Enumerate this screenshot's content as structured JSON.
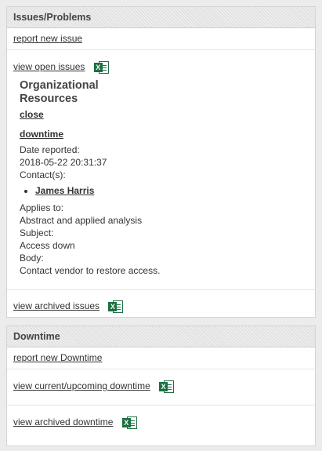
{
  "issues": {
    "header": "Issues/Problems",
    "report_link": "report new issue",
    "view_open_link": "view open issues",
    "detail": {
      "org_title_line1": "Organizational",
      "org_title_line2": "Resources",
      "close_label": "close",
      "issue_title": "downtime",
      "date_label": "Date reported:",
      "date_value": "2018-05-22 20:31:37",
      "contacts_label": "Contact(s):",
      "contacts": [
        "James Harris"
      ],
      "applies_label": "Applies to:",
      "applies_value": "Abstract and applied analysis",
      "subject_label": "Subject:",
      "subject_value": "Access down",
      "body_label": "Body:",
      "body_value": "Contact vendor to restore access."
    },
    "view_archived_link": "view archived issues"
  },
  "downtime": {
    "header": "Downtime",
    "report_link": "report new Downtime",
    "view_current_link": "view current/upcoming downtime",
    "view_archived_link": "view archived downtime"
  },
  "icons": {
    "excel": "excel-icon",
    "excel_letter": "X",
    "excel_color": "#1d6f42"
  }
}
